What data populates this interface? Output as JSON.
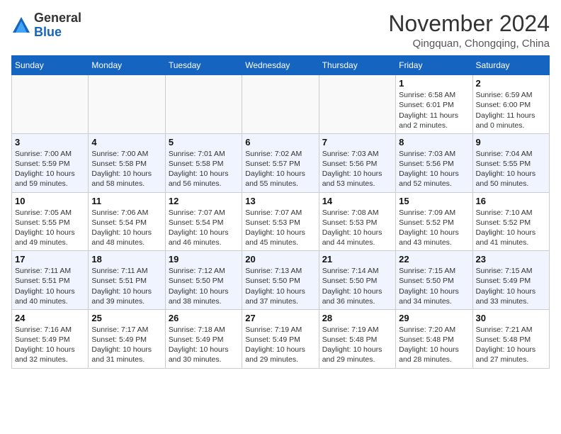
{
  "logo": {
    "general": "General",
    "blue": "Blue"
  },
  "title": "November 2024",
  "location": "Qingquan, Chongqing, China",
  "weekdays": [
    "Sunday",
    "Monday",
    "Tuesday",
    "Wednesday",
    "Thursday",
    "Friday",
    "Saturday"
  ],
  "weeks": [
    [
      {
        "day": "",
        "info": ""
      },
      {
        "day": "",
        "info": ""
      },
      {
        "day": "",
        "info": ""
      },
      {
        "day": "",
        "info": ""
      },
      {
        "day": "",
        "info": ""
      },
      {
        "day": "1",
        "info": "Sunrise: 6:58 AM\nSunset: 6:01 PM\nDaylight: 11 hours\nand 2 minutes."
      },
      {
        "day": "2",
        "info": "Sunrise: 6:59 AM\nSunset: 6:00 PM\nDaylight: 11 hours\nand 0 minutes."
      }
    ],
    [
      {
        "day": "3",
        "info": "Sunrise: 7:00 AM\nSunset: 5:59 PM\nDaylight: 10 hours\nand 59 minutes."
      },
      {
        "day": "4",
        "info": "Sunrise: 7:00 AM\nSunset: 5:58 PM\nDaylight: 10 hours\nand 58 minutes."
      },
      {
        "day": "5",
        "info": "Sunrise: 7:01 AM\nSunset: 5:58 PM\nDaylight: 10 hours\nand 56 minutes."
      },
      {
        "day": "6",
        "info": "Sunrise: 7:02 AM\nSunset: 5:57 PM\nDaylight: 10 hours\nand 55 minutes."
      },
      {
        "day": "7",
        "info": "Sunrise: 7:03 AM\nSunset: 5:56 PM\nDaylight: 10 hours\nand 53 minutes."
      },
      {
        "day": "8",
        "info": "Sunrise: 7:03 AM\nSunset: 5:56 PM\nDaylight: 10 hours\nand 52 minutes."
      },
      {
        "day": "9",
        "info": "Sunrise: 7:04 AM\nSunset: 5:55 PM\nDaylight: 10 hours\nand 50 minutes."
      }
    ],
    [
      {
        "day": "10",
        "info": "Sunrise: 7:05 AM\nSunset: 5:55 PM\nDaylight: 10 hours\nand 49 minutes."
      },
      {
        "day": "11",
        "info": "Sunrise: 7:06 AM\nSunset: 5:54 PM\nDaylight: 10 hours\nand 48 minutes."
      },
      {
        "day": "12",
        "info": "Sunrise: 7:07 AM\nSunset: 5:54 PM\nDaylight: 10 hours\nand 46 minutes."
      },
      {
        "day": "13",
        "info": "Sunrise: 7:07 AM\nSunset: 5:53 PM\nDaylight: 10 hours\nand 45 minutes."
      },
      {
        "day": "14",
        "info": "Sunrise: 7:08 AM\nSunset: 5:53 PM\nDaylight: 10 hours\nand 44 minutes."
      },
      {
        "day": "15",
        "info": "Sunrise: 7:09 AM\nSunset: 5:52 PM\nDaylight: 10 hours\nand 43 minutes."
      },
      {
        "day": "16",
        "info": "Sunrise: 7:10 AM\nSunset: 5:52 PM\nDaylight: 10 hours\nand 41 minutes."
      }
    ],
    [
      {
        "day": "17",
        "info": "Sunrise: 7:11 AM\nSunset: 5:51 PM\nDaylight: 10 hours\nand 40 minutes."
      },
      {
        "day": "18",
        "info": "Sunrise: 7:11 AM\nSunset: 5:51 PM\nDaylight: 10 hours\nand 39 minutes."
      },
      {
        "day": "19",
        "info": "Sunrise: 7:12 AM\nSunset: 5:50 PM\nDaylight: 10 hours\nand 38 minutes."
      },
      {
        "day": "20",
        "info": "Sunrise: 7:13 AM\nSunset: 5:50 PM\nDaylight: 10 hours\nand 37 minutes."
      },
      {
        "day": "21",
        "info": "Sunrise: 7:14 AM\nSunset: 5:50 PM\nDaylight: 10 hours\nand 36 minutes."
      },
      {
        "day": "22",
        "info": "Sunrise: 7:15 AM\nSunset: 5:50 PM\nDaylight: 10 hours\nand 34 minutes."
      },
      {
        "day": "23",
        "info": "Sunrise: 7:15 AM\nSunset: 5:49 PM\nDaylight: 10 hours\nand 33 minutes."
      }
    ],
    [
      {
        "day": "24",
        "info": "Sunrise: 7:16 AM\nSunset: 5:49 PM\nDaylight: 10 hours\nand 32 minutes."
      },
      {
        "day": "25",
        "info": "Sunrise: 7:17 AM\nSunset: 5:49 PM\nDaylight: 10 hours\nand 31 minutes."
      },
      {
        "day": "26",
        "info": "Sunrise: 7:18 AM\nSunset: 5:49 PM\nDaylight: 10 hours\nand 30 minutes."
      },
      {
        "day": "27",
        "info": "Sunrise: 7:19 AM\nSunset: 5:49 PM\nDaylight: 10 hours\nand 29 minutes."
      },
      {
        "day": "28",
        "info": "Sunrise: 7:19 AM\nSunset: 5:48 PM\nDaylight: 10 hours\nand 29 minutes."
      },
      {
        "day": "29",
        "info": "Sunrise: 7:20 AM\nSunset: 5:48 PM\nDaylight: 10 hours\nand 28 minutes."
      },
      {
        "day": "30",
        "info": "Sunrise: 7:21 AM\nSunset: 5:48 PM\nDaylight: 10 hours\nand 27 minutes."
      }
    ]
  ]
}
